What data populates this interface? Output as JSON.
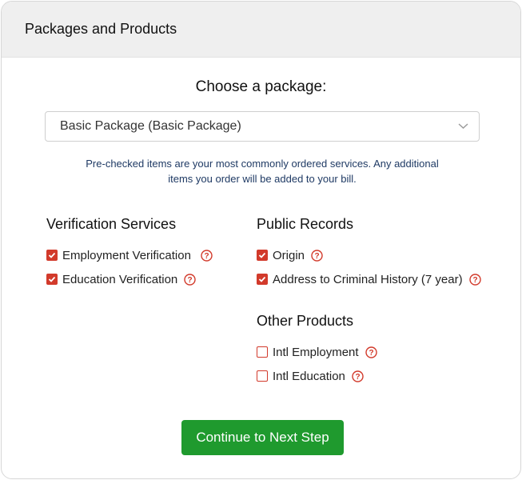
{
  "panel": {
    "title": "Packages and Products"
  },
  "package": {
    "heading": "Choose a package:",
    "selected": "Basic Package (Basic Package)",
    "note": "Pre-checked items are your most commonly ordered services. Any additional items you order will be added to your bill."
  },
  "verification": {
    "title": "Verification Services",
    "items": [
      {
        "label": "Employment Verification",
        "checked": true
      },
      {
        "label": "Education Verification",
        "checked": true
      }
    ]
  },
  "public_records": {
    "title": "Public Records",
    "items": [
      {
        "label": "Origin",
        "checked": true
      },
      {
        "label": "Address to Criminal History (7 year)",
        "checked": true
      }
    ]
  },
  "other_products": {
    "title": "Other Products",
    "items": [
      {
        "label": "Intl Employment",
        "checked": false
      },
      {
        "label": "Intl Education",
        "checked": false
      }
    ]
  },
  "actions": {
    "continue_label": "Continue to Next Step"
  },
  "colors": {
    "accent_red": "#d23a2b",
    "button_green": "#1f9a2e"
  }
}
